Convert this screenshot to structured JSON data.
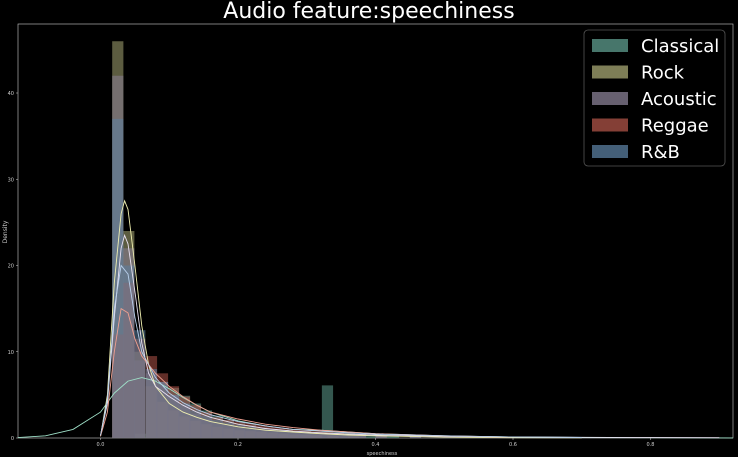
{
  "chart_data": {
    "type": "histogram-density",
    "title": "Audio feature:speechiness",
    "xlabel": "speechiness",
    "ylabel": "Density",
    "xlim": [
      -0.12,
      0.92
    ],
    "ylim": [
      0,
      48
    ],
    "xticks": [
      0.0,
      0.2,
      0.4,
      0.6,
      0.8
    ],
    "xtick_labels": [
      "0.0",
      "0.2",
      "0.4",
      "0.6",
      "0.8"
    ],
    "yticks": [
      0,
      10,
      20,
      30,
      40
    ],
    "ytick_labels": [
      "0",
      "10",
      "20",
      "30",
      "40"
    ],
    "grid": false,
    "legend_position": "top-right",
    "bin_width": 0.0163,
    "series": [
      {
        "name": "Classical",
        "color": "#5f9e8f",
        "bins": [
          [
            0.05,
            0.5
          ],
          [
            0.066,
            6.8
          ],
          [
            0.082,
            6.5
          ],
          [
            0.098,
            5.8
          ],
          [
            0.114,
            4.9
          ],
          [
            0.13,
            4.0
          ],
          [
            0.146,
            3.2
          ],
          [
            0.162,
            2.6
          ],
          [
            0.178,
            2.1
          ],
          [
            0.194,
            1.7
          ],
          [
            0.21,
            1.5
          ],
          [
            0.226,
            1.2
          ],
          [
            0.242,
            1.0
          ],
          [
            0.258,
            0.9
          ],
          [
            0.274,
            0.8
          ],
          [
            0.29,
            0.8
          ],
          [
            0.306,
            0.7
          ],
          [
            0.322,
            6.1
          ],
          [
            0.338,
            0.8
          ],
          [
            0.354,
            0.6
          ],
          [
            0.37,
            0.5
          ],
          [
            0.386,
            0.4
          ],
          [
            0.402,
            0.3
          ],
          [
            0.418,
            0.25
          ],
          [
            0.45,
            0.2
          ],
          [
            0.5,
            0.15
          ],
          [
            0.55,
            0.1
          ],
          [
            0.6,
            0.08
          ],
          [
            0.7,
            0.05
          ]
        ],
        "kde": [
          [
            -0.12,
            0.05
          ],
          [
            -0.08,
            0.25
          ],
          [
            -0.04,
            1.0
          ],
          [
            0.0,
            3.0
          ],
          [
            0.02,
            5.2
          ],
          [
            0.04,
            6.6
          ],
          [
            0.06,
            7.0
          ],
          [
            0.08,
            6.6
          ],
          [
            0.1,
            5.7
          ],
          [
            0.12,
            4.7
          ],
          [
            0.14,
            3.8
          ],
          [
            0.16,
            3.0
          ],
          [
            0.2,
            2.0
          ],
          [
            0.24,
            1.4
          ],
          [
            0.28,
            1.0
          ],
          [
            0.32,
            0.9
          ],
          [
            0.36,
            0.7
          ],
          [
            0.4,
            0.5
          ],
          [
            0.5,
            0.25
          ],
          [
            0.6,
            0.12
          ],
          [
            0.7,
            0.06
          ],
          [
            0.8,
            0.03
          ],
          [
            0.92,
            0.01
          ]
        ]
      },
      {
        "name": "Rock",
        "color": "#a8a874",
        "bins": [
          [
            0.017,
            46.0
          ],
          [
            0.033,
            24.0
          ],
          [
            0.049,
            10.0
          ],
          [
            0.066,
            6.0
          ],
          [
            0.082,
            4.2
          ],
          [
            0.098,
            3.2
          ],
          [
            0.114,
            2.5
          ],
          [
            0.13,
            2.0
          ],
          [
            0.146,
            1.6
          ],
          [
            0.162,
            1.3
          ],
          [
            0.178,
            1.1
          ],
          [
            0.194,
            0.9
          ],
          [
            0.21,
            0.8
          ],
          [
            0.226,
            0.7
          ],
          [
            0.242,
            0.6
          ],
          [
            0.258,
            0.5
          ],
          [
            0.274,
            0.4
          ],
          [
            0.29,
            0.35
          ],
          [
            0.306,
            0.3
          ],
          [
            0.33,
            0.25
          ],
          [
            0.36,
            0.2
          ],
          [
            0.4,
            0.15
          ]
        ],
        "kde": [
          [
            0.0,
            0.2
          ],
          [
            0.01,
            5.0
          ],
          [
            0.02,
            18.0
          ],
          [
            0.03,
            26.0
          ],
          [
            0.035,
            27.5
          ],
          [
            0.04,
            26.5
          ],
          [
            0.05,
            20.0
          ],
          [
            0.06,
            13.0
          ],
          [
            0.07,
            8.5
          ],
          [
            0.08,
            6.0
          ],
          [
            0.1,
            4.0
          ],
          [
            0.12,
            3.0
          ],
          [
            0.14,
            2.4
          ],
          [
            0.16,
            1.9
          ],
          [
            0.2,
            1.3
          ],
          [
            0.24,
            0.9
          ],
          [
            0.28,
            0.7
          ],
          [
            0.32,
            0.5
          ],
          [
            0.36,
            0.35
          ],
          [
            0.4,
            0.25
          ],
          [
            0.5,
            0.1
          ],
          [
            0.6,
            0.04
          ],
          [
            0.7,
            0.02
          ]
        ]
      },
      {
        "name": "Acoustic",
        "color": "#8a8096",
        "bins": [
          [
            0.017,
            42.0
          ],
          [
            0.033,
            22.0
          ],
          [
            0.049,
            9.0
          ],
          [
            0.066,
            7.5
          ],
          [
            0.082,
            6.5
          ],
          [
            0.098,
            5.0
          ],
          [
            0.114,
            3.8
          ],
          [
            0.13,
            2.8
          ],
          [
            0.146,
            2.2
          ],
          [
            0.162,
            1.8
          ],
          [
            0.178,
            1.5
          ],
          [
            0.194,
            1.2
          ],
          [
            0.21,
            1.0
          ],
          [
            0.226,
            0.9
          ],
          [
            0.242,
            0.8
          ],
          [
            0.258,
            0.7
          ],
          [
            0.274,
            0.6
          ],
          [
            0.29,
            0.55
          ],
          [
            0.306,
            0.5
          ],
          [
            0.322,
            0.45
          ],
          [
            0.338,
            0.4
          ],
          [
            0.354,
            0.35
          ],
          [
            0.37,
            0.3
          ],
          [
            0.4,
            0.25
          ],
          [
            0.45,
            0.2
          ],
          [
            0.5,
            0.15
          ],
          [
            0.55,
            0.1
          ],
          [
            0.6,
            0.08
          ],
          [
            0.65,
            0.06
          ],
          [
            0.7,
            0.05
          ],
          [
            0.75,
            0.05
          ],
          [
            0.8,
            0.04
          ],
          [
            0.85,
            0.03
          ],
          [
            0.9,
            0.03
          ]
        ],
        "kde": [
          [
            0.0,
            0.3
          ],
          [
            0.01,
            4.0
          ],
          [
            0.02,
            14.0
          ],
          [
            0.03,
            22.0
          ],
          [
            0.035,
            23.5
          ],
          [
            0.04,
            22.5
          ],
          [
            0.05,
            17.0
          ],
          [
            0.06,
            11.0
          ],
          [
            0.07,
            7.5
          ],
          [
            0.08,
            6.0
          ],
          [
            0.1,
            4.8
          ],
          [
            0.12,
            3.8
          ],
          [
            0.14,
            3.0
          ],
          [
            0.16,
            2.4
          ],
          [
            0.2,
            1.6
          ],
          [
            0.24,
            1.1
          ],
          [
            0.28,
            0.8
          ],
          [
            0.32,
            0.6
          ],
          [
            0.36,
            0.45
          ],
          [
            0.4,
            0.35
          ],
          [
            0.5,
            0.2
          ],
          [
            0.6,
            0.12
          ],
          [
            0.7,
            0.08
          ],
          [
            0.8,
            0.05
          ],
          [
            0.9,
            0.04
          ]
        ]
      },
      {
        "name": "Reggae",
        "color": "#b05448",
        "bins": [
          [
            0.017,
            12.0
          ],
          [
            0.033,
            18.0
          ],
          [
            0.049,
            11.5
          ],
          [
            0.066,
            9.5
          ],
          [
            0.082,
            7.5
          ],
          [
            0.098,
            6.0
          ],
          [
            0.114,
            4.8
          ],
          [
            0.13,
            3.8
          ],
          [
            0.146,
            3.0
          ],
          [
            0.162,
            2.4
          ],
          [
            0.178,
            2.1
          ],
          [
            0.194,
            1.9
          ],
          [
            0.21,
            1.7
          ],
          [
            0.226,
            1.5
          ],
          [
            0.242,
            1.3
          ],
          [
            0.258,
            1.2
          ],
          [
            0.274,
            1.0
          ],
          [
            0.29,
            0.9
          ],
          [
            0.306,
            0.8
          ],
          [
            0.322,
            0.7
          ],
          [
            0.338,
            0.6
          ],
          [
            0.354,
            0.5
          ],
          [
            0.37,
            0.4
          ],
          [
            0.4,
            0.3
          ],
          [
            0.45,
            0.2
          ],
          [
            0.5,
            0.15
          ]
        ],
        "kde": [
          [
            0.0,
            0.2
          ],
          [
            0.01,
            3.0
          ],
          [
            0.02,
            10.0
          ],
          [
            0.03,
            15.0
          ],
          [
            0.04,
            14.5
          ],
          [
            0.05,
            11.5
          ],
          [
            0.06,
            9.5
          ],
          [
            0.08,
            7.5
          ],
          [
            0.1,
            6.0
          ],
          [
            0.12,
            4.8
          ],
          [
            0.14,
            3.8
          ],
          [
            0.16,
            3.0
          ],
          [
            0.2,
            2.2
          ],
          [
            0.24,
            1.6
          ],
          [
            0.28,
            1.2
          ],
          [
            0.32,
            0.9
          ],
          [
            0.36,
            0.7
          ],
          [
            0.4,
            0.5
          ],
          [
            0.5,
            0.25
          ],
          [
            0.6,
            0.1
          ]
        ]
      },
      {
        "name": "R&B",
        "color": "#5b7fa0",
        "bins": [
          [
            0.017,
            37.0
          ],
          [
            0.033,
            20.0
          ],
          [
            0.049,
            12.5
          ],
          [
            0.066,
            8.0
          ],
          [
            0.082,
            6.5
          ],
          [
            0.098,
            5.0
          ],
          [
            0.114,
            4.0
          ],
          [
            0.13,
            3.2
          ],
          [
            0.146,
            2.6
          ],
          [
            0.162,
            2.1
          ],
          [
            0.178,
            1.8
          ],
          [
            0.194,
            1.5
          ],
          [
            0.21,
            1.3
          ],
          [
            0.226,
            1.1
          ],
          [
            0.242,
            1.0
          ],
          [
            0.258,
            0.9
          ],
          [
            0.274,
            0.8
          ],
          [
            0.29,
            0.7
          ],
          [
            0.306,
            0.6
          ],
          [
            0.322,
            0.5
          ],
          [
            0.338,
            0.45
          ],
          [
            0.354,
            0.4
          ],
          [
            0.37,
            0.35
          ],
          [
            0.4,
            0.3
          ],
          [
            0.45,
            0.25
          ],
          [
            0.5,
            0.2
          ],
          [
            0.55,
            0.15
          ],
          [
            0.6,
            0.1
          ]
        ],
        "kde": [
          [
            0.0,
            0.3
          ],
          [
            0.01,
            4.5
          ],
          [
            0.02,
            15.0
          ],
          [
            0.03,
            20.0
          ],
          [
            0.04,
            19.0
          ],
          [
            0.05,
            14.0
          ],
          [
            0.06,
            10.0
          ],
          [
            0.08,
            7.0
          ],
          [
            0.1,
            5.2
          ],
          [
            0.12,
            4.1
          ],
          [
            0.14,
            3.3
          ],
          [
            0.16,
            2.7
          ],
          [
            0.2,
            1.9
          ],
          [
            0.24,
            1.4
          ],
          [
            0.28,
            1.0
          ],
          [
            0.32,
            0.8
          ],
          [
            0.36,
            0.6
          ],
          [
            0.4,
            0.45
          ],
          [
            0.5,
            0.25
          ],
          [
            0.6,
            0.12
          ],
          [
            0.7,
            0.06
          ]
        ]
      }
    ]
  }
}
